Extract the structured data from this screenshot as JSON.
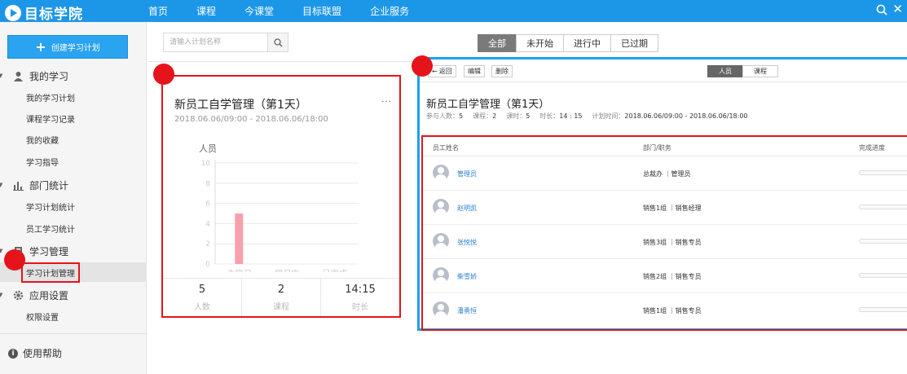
{
  "header": {
    "logo_text": "目标学院",
    "nav": [
      "首页",
      "课程",
      "今课堂",
      "目标联盟",
      "企业服务"
    ]
  },
  "sidebar": {
    "create_button": "创建学习计划",
    "sections": [
      {
        "label": "我的学习",
        "icon": "user-icon",
        "items": [
          "我的学习计划",
          "课程学习记录",
          "我的收藏",
          "学习指导"
        ]
      },
      {
        "label": "部门统计",
        "icon": "bar-chart-icon",
        "items": [
          "学习计划统计",
          "员工学习统计"
        ]
      },
      {
        "label": "学习管理",
        "icon": "book-icon",
        "items": [
          "学习计划管理"
        ]
      },
      {
        "label": "应用设置",
        "icon": "gear-icon",
        "items": [
          "权限设置"
        ]
      }
    ],
    "active_item": "学习计划管理",
    "help": "使用帮助"
  },
  "toolbar": {
    "search_placeholder": "请输入计划名称",
    "filters": [
      "全部",
      "未开始",
      "进行中",
      "已过期"
    ],
    "active_filter": "全部"
  },
  "plan_card": {
    "title": "新员工自学管理（第1天）",
    "date": "2018.06.06/09:00 - 2018.06.06/18:00",
    "stats": [
      {
        "value": "5",
        "label": "人数"
      },
      {
        "value": "2",
        "label": "课程"
      },
      {
        "value": "14:15",
        "label": "时长"
      }
    ]
  },
  "chart_data": {
    "type": "bar",
    "ylabel": "人员",
    "categories": [
      "未学习",
      "学习中",
      "已完成"
    ],
    "values": [
      5,
      0,
      0
    ],
    "ylim": [
      0,
      10
    ],
    "yticks": [
      "0",
      "2",
      "4",
      "6",
      "8",
      "10"
    ],
    "grid": true,
    "bar_color": "#f7a1ac"
  },
  "detail": {
    "buttons": [
      "返回",
      "编辑",
      "删除"
    ],
    "tabs": [
      "人员",
      "课程"
    ],
    "active_tab": "人员",
    "title": "新员工自学管理（第1天）",
    "meta": [
      {
        "label": "参与人数：",
        "value": "5"
      },
      {
        "label": "课程：",
        "value": "2"
      },
      {
        "label": "课时：",
        "value": "5"
      },
      {
        "label": "时长：",
        "value": "14 : 15"
      },
      {
        "label": "计划时间：",
        "value": "2018.06.06/09:00 - 2018.06.06/18:00"
      }
    ],
    "columns": [
      "员工姓名",
      "部门/职务",
      "完成进度"
    ],
    "rows": [
      {
        "name": "管理员",
        "dept": "总裁办 ｜管理员"
      },
      {
        "name": "赵明凯",
        "dept": "销售1组 ｜销售经理"
      },
      {
        "name": "张悦悦",
        "dept": "销售3组 ｜销售专员"
      },
      {
        "name": "柴雪娇",
        "dept": "销售2组 ｜销售专员"
      },
      {
        "name": "潘勇恒",
        "dept": "销售1组 ｜销售专员"
      }
    ]
  },
  "colors": {
    "topbar": "#1c97e8",
    "accent": "#2aa3f0",
    "highlight": "#e5141b",
    "panel_border": "#1aa3e8"
  }
}
